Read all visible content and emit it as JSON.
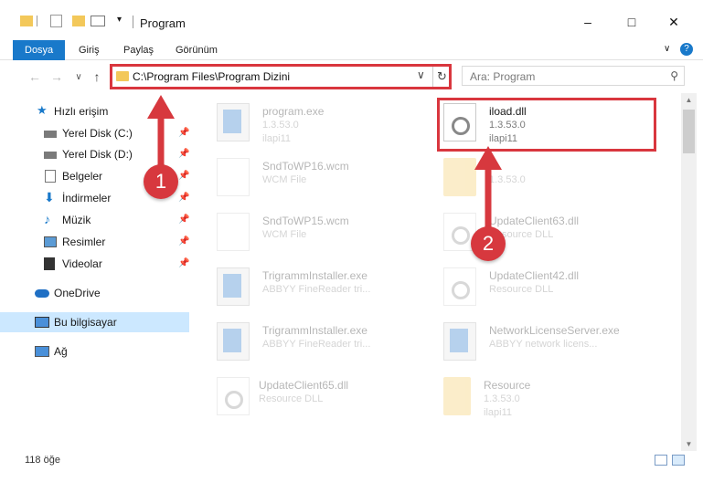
{
  "window": {
    "title": "Program",
    "minimize": "–",
    "maximize": "□",
    "close": "✕"
  },
  "ribbon": {
    "tabs": [
      "Dosya",
      "Giriş",
      "Paylaş",
      "Görünüm"
    ],
    "help": "?"
  },
  "address": {
    "path": "C:\\Program Files\\Program Dizini",
    "dropdown": "∨",
    "refresh": "↻"
  },
  "search": {
    "placeholder": "Ara: Program",
    "icon": "search-icon"
  },
  "navigation": {
    "back": "←",
    "forward": "→",
    "recent": "∨",
    "up": "↑"
  },
  "sidebar": {
    "items": [
      {
        "label": "Hızlı erişim",
        "icon": "star-icon",
        "pinned": false
      },
      {
        "label": "Yerel Disk (C:)",
        "icon": "drive-icon",
        "pinned": true
      },
      {
        "label": "Yerel Disk (D:)",
        "icon": "drive-icon",
        "pinned": true
      },
      {
        "label": "Belgeler",
        "icon": "document-icon",
        "pinned": true
      },
      {
        "label": "İndirmeler",
        "icon": "download-icon",
        "pinned": true
      },
      {
        "label": "Müzik",
        "icon": "music-icon",
        "pinned": true
      },
      {
        "label": "Resimler",
        "icon": "image-icon",
        "pinned": true
      },
      {
        "label": "Videolar",
        "icon": "video-icon",
        "pinned": true
      },
      {
        "label": "OneDrive",
        "icon": "cloud-icon",
        "pinned": false
      },
      {
        "label": "Bu bilgisayar",
        "icon": "computer-icon",
        "pinned": false,
        "selected": true
      },
      {
        "label": "Ağ",
        "icon": "network-icon",
        "pinned": false
      }
    ],
    "pin_glyph": "📌"
  },
  "files": [
    {
      "name": "program.exe",
      "meta1": "1.3.53.0",
      "meta2": "ilapi11",
      "type": "exe",
      "faded": true
    },
    {
      "name": "iload.dll",
      "meta1": "1.3.53.0",
      "meta2": "ilapi11",
      "type": "dll",
      "faded": false,
      "highlighted": true
    },
    {
      "name": "SndToWP16.wcm",
      "meta1": "WCM File",
      "meta2": "",
      "type": "doc",
      "faded": true
    },
    {
      "name": "",
      "meta1": "1.3.53.0",
      "meta2": "",
      "type": "folder",
      "faded": true
    },
    {
      "name": "SndToWP15.wcm",
      "meta1": "WCM File",
      "meta2": "",
      "type": "doc",
      "faded": true
    },
    {
      "name": "UpdateClient63.dll",
      "meta1": "Resource DLL",
      "meta2": "",
      "type": "dll",
      "faded": true
    },
    {
      "name": "TrigrammInstaller.exe",
      "meta1": "ABBYY FineReader tri...",
      "meta2": "",
      "type": "app",
      "faded": true
    },
    {
      "name": "UpdateClient42.dll",
      "meta1": "Resource DLL",
      "meta2": "",
      "type": "dll",
      "faded": true
    },
    {
      "name": "TrigrammInstaller.exe",
      "meta1": "ABBYY FineReader tri...",
      "meta2": "",
      "type": "app",
      "faded": true
    },
    {
      "name": "NetworkLicenseServer.exe",
      "meta1": "ABBYY network licens...",
      "meta2": "",
      "type": "app",
      "faded": true
    },
    {
      "name": "UpdateClient65.dll",
      "meta1": "Resource DLL",
      "meta2": "",
      "type": "dll",
      "faded": true
    },
    {
      "name": "Resource",
      "meta1": "1.3.53.0",
      "meta2": "ilapi11",
      "type": "folder",
      "faded": true
    }
  ],
  "annotations": {
    "badge1": "1",
    "badge2": "2",
    "color": "#d7383e"
  },
  "status": {
    "count": "118 öğe"
  },
  "colors": {
    "accent": "#1979ca",
    "highlight": "#d9363e",
    "selected_bg": "#cce8ff"
  }
}
